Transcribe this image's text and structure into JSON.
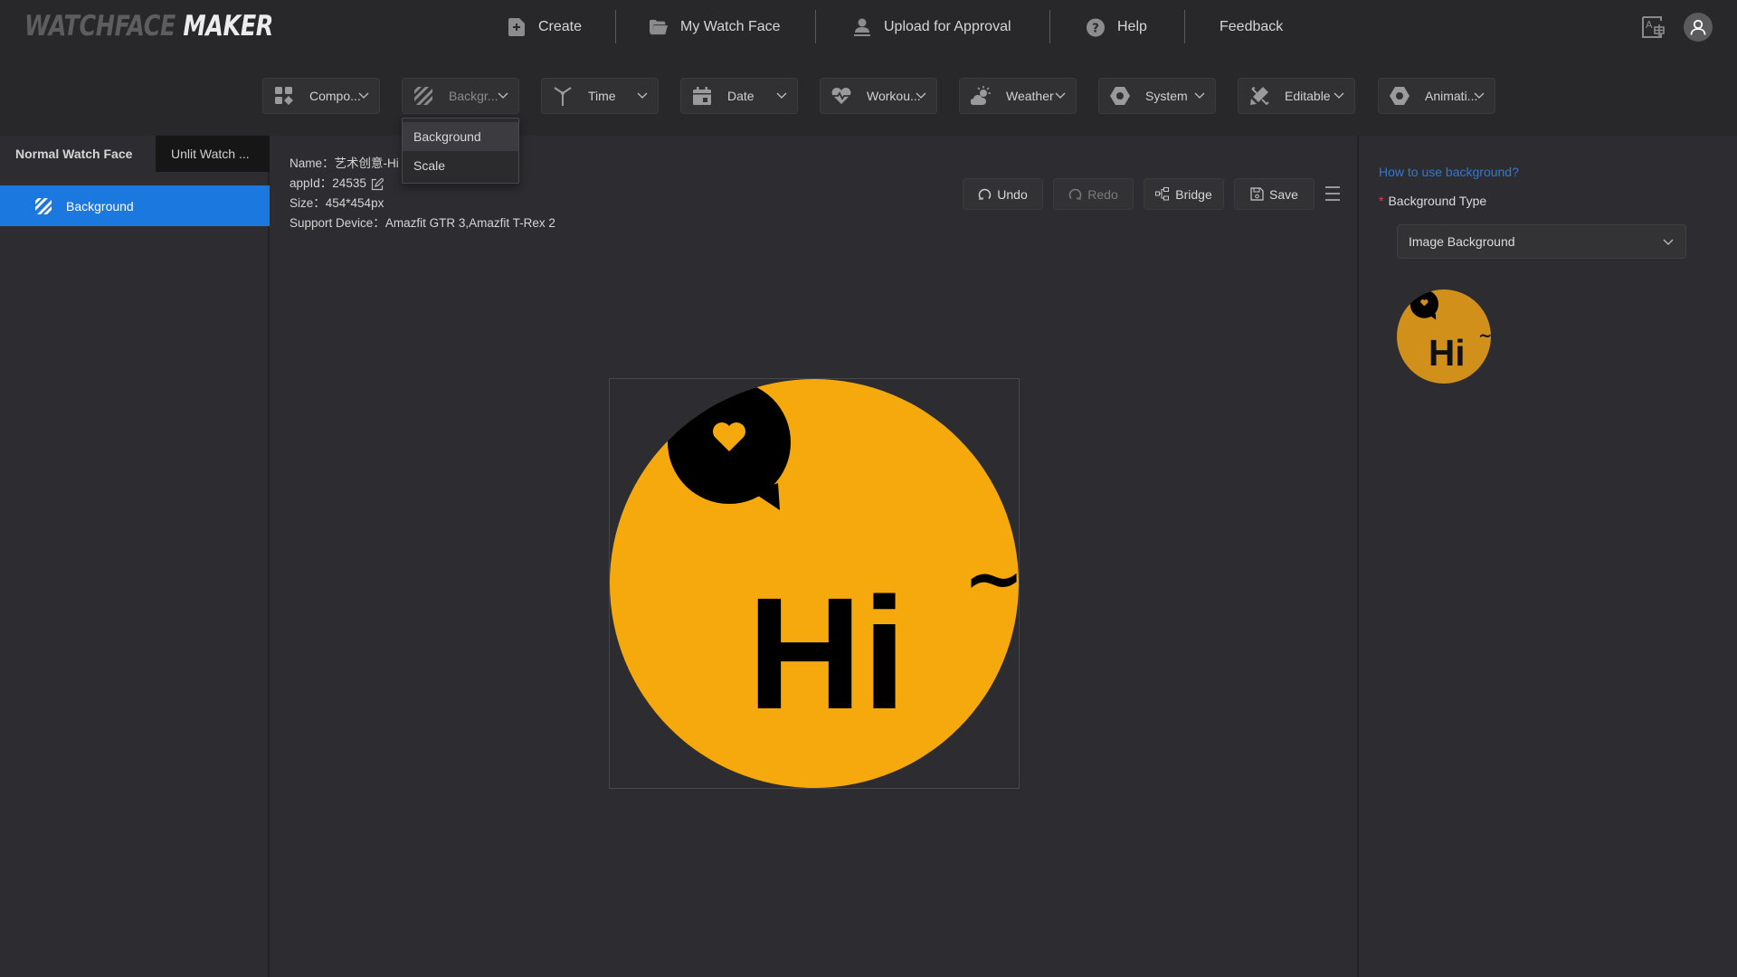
{
  "app": {
    "logo_part1": "WATCHFACE",
    "logo_part2": "MAKER"
  },
  "nav": {
    "items": [
      {
        "label": "Create",
        "icon": "file-plus-icon"
      },
      {
        "label": "My Watch Face",
        "icon": "folder-open-icon"
      },
      {
        "label": "Upload for Approval",
        "icon": "user-upload-icon"
      },
      {
        "label": "Help",
        "icon": "question-circle-icon"
      },
      {
        "label": "Feedback",
        "icon": ""
      }
    ],
    "translate_icon": "translate-icon",
    "avatar_icon": "user-avatar-icon"
  },
  "toolbar": {
    "items": [
      {
        "label": "Compo...",
        "icon": "components-icon"
      },
      {
        "label": "Backgr...",
        "icon": "background-hatch-icon"
      },
      {
        "label": "Time",
        "icon": "clock-hands-icon"
      },
      {
        "label": "Date",
        "icon": "calendar-icon"
      },
      {
        "label": "Workou...",
        "icon": "heart-rate-icon"
      },
      {
        "label": "Weather",
        "icon": "weather-icon"
      },
      {
        "label": "System",
        "icon": "hexagon-nut-icon"
      },
      {
        "label": "Editable",
        "icon": "editable-icon"
      },
      {
        "label": "Animati...",
        "icon": "hexagon-nut-icon"
      }
    ],
    "dropdown": {
      "open_for": "Backgr...",
      "items": [
        {
          "label": "Background",
          "highlighted": true
        },
        {
          "label": "Scale",
          "highlighted": false
        }
      ]
    }
  },
  "sidebar": {
    "tabs": [
      {
        "label": "Normal Watch Face",
        "active": true
      },
      {
        "label": "Unlit Watch ...",
        "active": false
      }
    ],
    "layers": [
      {
        "label": "Background",
        "icon": "background-hatch-icon",
        "selected": true
      }
    ]
  },
  "main": {
    "info": {
      "name_label": "Name：",
      "name_value": "艺术创意-Hi",
      "appid_label": "appId：",
      "appid_value": "24535",
      "size_label": "Size：",
      "size_value": "454*454px",
      "device_label": "Support Device：",
      "device_value": "Amazfit GTR 3,Amazfit T-Rex 2"
    },
    "actions": [
      {
        "label": "Undo",
        "icon": "undo-icon",
        "enabled": true
      },
      {
        "label": "Redo",
        "icon": "redo-icon",
        "enabled": false
      },
      {
        "label": "Bridge",
        "icon": "bridge-icon",
        "enabled": true
      },
      {
        "label": "Save",
        "icon": "save-icon",
        "enabled": true
      }
    ],
    "menu_icon": "hamburger-menu-icon",
    "watchface": {
      "text": "Hi",
      "tilde": "~",
      "bg_color": "#f5a90c",
      "fg_color": "#000000"
    }
  },
  "right_panel": {
    "help_link": "How to use background?",
    "field_label": "Background Type",
    "required_mark": "*",
    "select_value": "Image Background",
    "thumbnail_color": "#d0901a"
  },
  "colors": {
    "accent_blue": "#1b78df",
    "link_blue": "#2f78d6",
    "required_red": "#e0404a"
  }
}
